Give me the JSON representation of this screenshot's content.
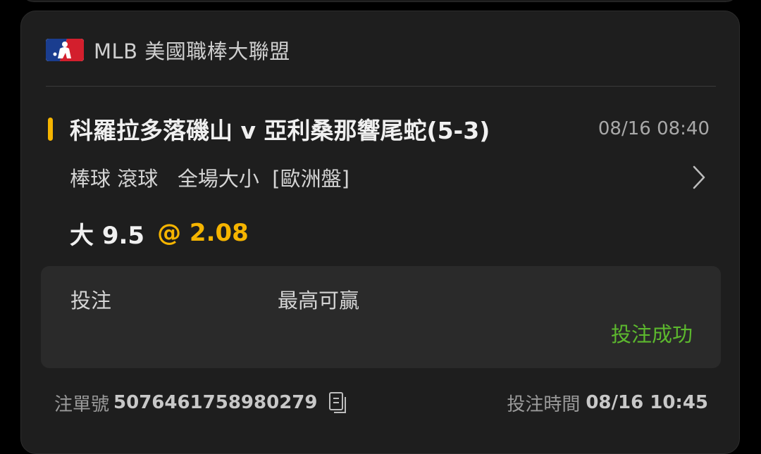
{
  "league": {
    "icon": "mlb-logo",
    "name": "MLB 美國職棒大聯盟"
  },
  "match": {
    "title": "科羅拉多落磯山 v 亞利桑那響尾蛇(5-3)",
    "time": "08/16 08:40",
    "market": "棒球 滾球   全場大小  [歐洲盤]",
    "selection": "大 9.5",
    "odds": "@ 2.08"
  },
  "stake": {
    "stake_label": "投注",
    "max_win_label": "最高可贏",
    "status": "投注成功"
  },
  "footer": {
    "order_label": "注單號",
    "order_no": "5076461758980279",
    "time_label": "投注時間",
    "time_value": "08/16 10:45"
  },
  "colors": {
    "accent": "#f5b400",
    "success": "#5cb82e",
    "card_bg": "#1e1e1e",
    "page_bg": "#000000"
  }
}
